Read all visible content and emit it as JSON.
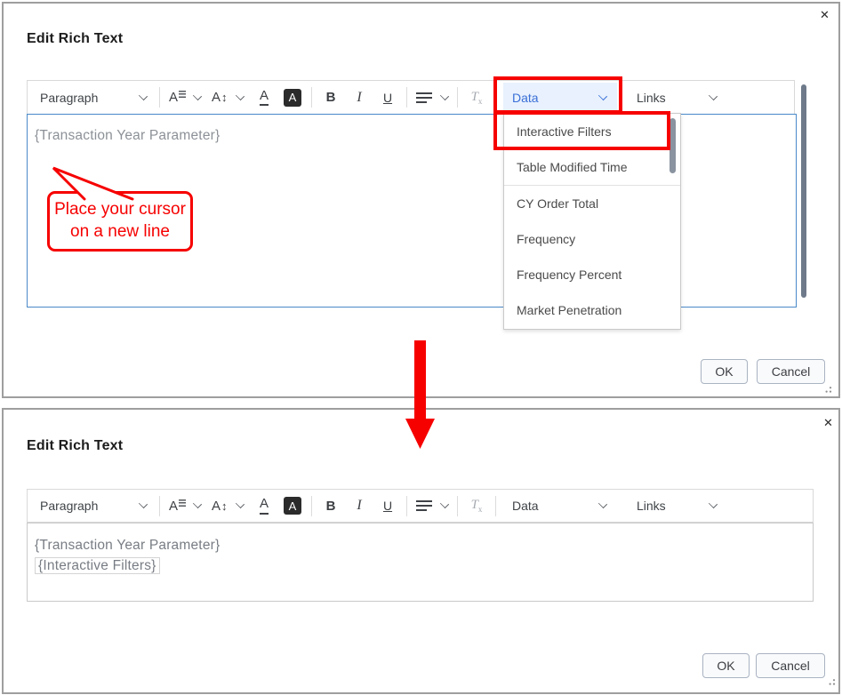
{
  "window": {
    "title": "Edit Rich Text",
    "close_icon": "✕",
    "ok": "OK",
    "cancel": "Cancel"
  },
  "toolbar": {
    "paragraph": "Paragraph",
    "font_face_icon": "A",
    "font_size_icon": "A",
    "font_size_arrow": "↕",
    "text_color_icon": "A",
    "highlight_icon": "A",
    "bold": "B",
    "italic": "I",
    "underline": "U",
    "clear_format_icon": "T",
    "clear_format_sub": "x",
    "data": "Data",
    "links": "Links"
  },
  "top_dialog": {
    "editor_text": "{Transaction Year Parameter}",
    "callout": {
      "line1": "Place your cursor",
      "line2": "on a new line"
    },
    "menu_items": [
      "Interactive Filters",
      "Table Modified Time",
      "CY Order Total",
      "Frequency",
      "Frequency Percent",
      "Market Penetration"
    ],
    "menu_highlighted_item": "Interactive Filters"
  },
  "bottom_dialog": {
    "editor_line1": "{Transaction Year Parameter}",
    "editor_line2": "{Interactive Filters}"
  },
  "colors": {
    "annotation_red": "#f60000",
    "data_highlight_bg": "#e8f1fd",
    "data_highlight_text": "#3a6fd8",
    "focused_editor_border": "#4a89c8"
  }
}
